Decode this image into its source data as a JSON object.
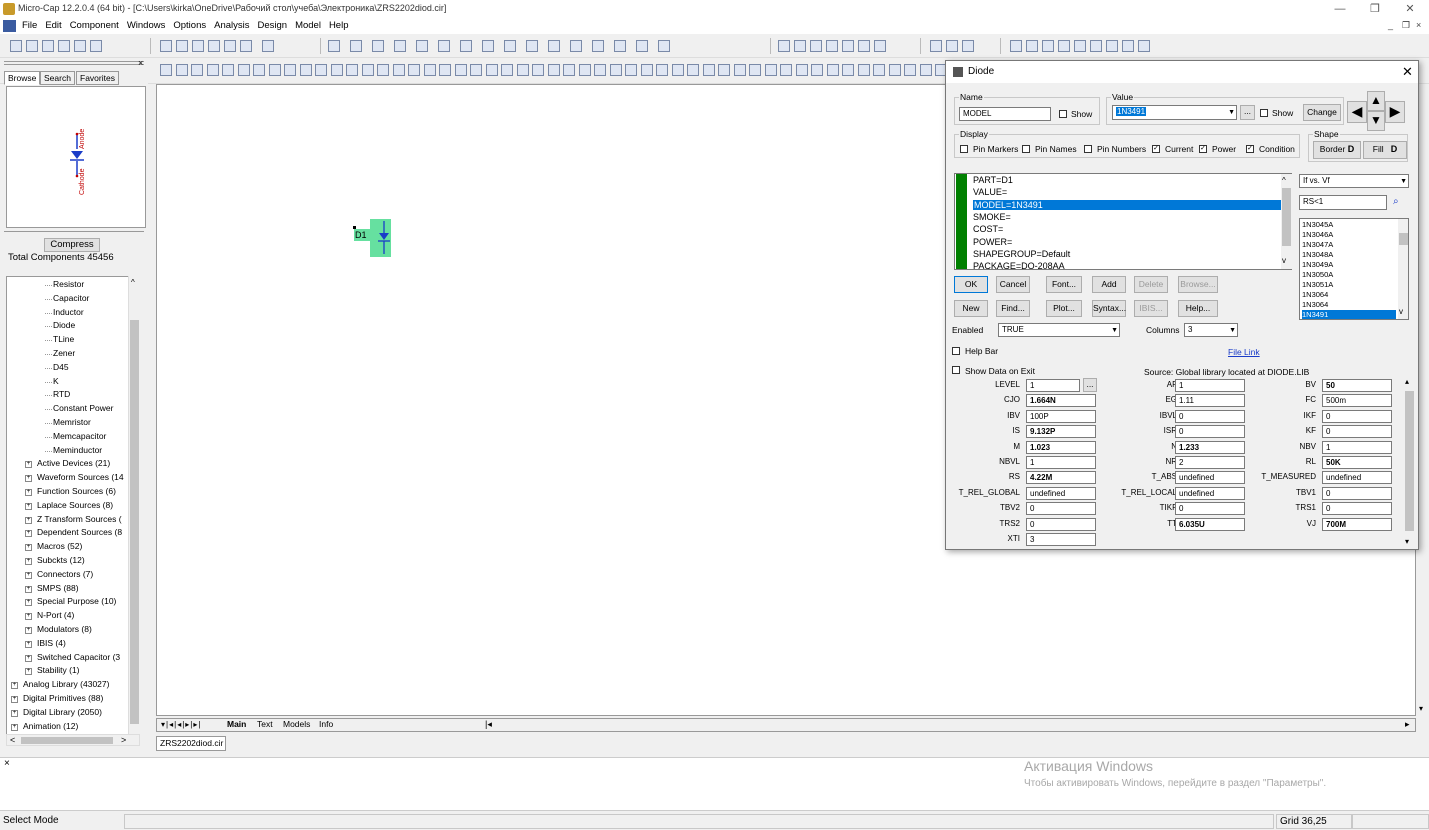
{
  "window": {
    "title": "Micro-Cap 12.2.0.4 (64 bit) - [C:\\Users\\kirka\\OneDrive\\Рабочий стол\\учеба\\Электроника\\ZRS2202diod.cir]",
    "minimize": "—",
    "restore": "❐",
    "close": "✕"
  },
  "menu": [
    "File",
    "Edit",
    "Component",
    "Windows",
    "Options",
    "Analysis",
    "Design",
    "Model",
    "Help"
  ],
  "left_panel": {
    "tabs": [
      "Browse",
      "Search",
      "Favorites"
    ],
    "preview_labels": {
      "anode": "Anode",
      "cathode": "Cathode"
    },
    "compress_button": "Compress",
    "total_components": "Total Components 45456",
    "tree": [
      {
        "label": "Resistor",
        "level": 3
      },
      {
        "label": "Capacitor",
        "level": 3
      },
      {
        "label": "Inductor",
        "level": 3
      },
      {
        "label": "Diode",
        "level": 3
      },
      {
        "label": "TLine",
        "level": 3
      },
      {
        "label": "Zener",
        "level": 3
      },
      {
        "label": "D45",
        "level": 3
      },
      {
        "label": "K",
        "level": 3
      },
      {
        "label": "RTD",
        "level": 3
      },
      {
        "label": "Constant Power",
        "level": 3
      },
      {
        "label": "Memristor",
        "level": 3
      },
      {
        "label": "Memcapacitor",
        "level": 3
      },
      {
        "label": "Meminductor",
        "level": 3
      },
      {
        "label": "Active Devices (21)",
        "level": 2
      },
      {
        "label": "Waveform Sources (14",
        "level": 2
      },
      {
        "label": "Function Sources (6)",
        "level": 2
      },
      {
        "label": "Laplace Sources (8)",
        "level": 2
      },
      {
        "label": "Z Transform Sources (",
        "level": 2
      },
      {
        "label": "Dependent Sources (8",
        "level": 2
      },
      {
        "label": "Macros (52)",
        "level": 2
      },
      {
        "label": "Subckts (12)",
        "level": 2
      },
      {
        "label": "Connectors (7)",
        "level": 2
      },
      {
        "label": "SMPS (88)",
        "level": 2
      },
      {
        "label": "Special Purpose (10)",
        "level": 2
      },
      {
        "label": "N-Port (4)",
        "level": 2
      },
      {
        "label": "Modulators (8)",
        "level": 2
      },
      {
        "label": "IBIS (4)",
        "level": 2
      },
      {
        "label": "Switched Capacitor (3",
        "level": 2
      },
      {
        "label": "Stability (1)",
        "level": 2
      },
      {
        "label": "Analog Library (43027)",
        "level": 1
      },
      {
        "label": "Digital Primitives (88)",
        "level": 1
      },
      {
        "label": "Digital Library (2050)",
        "level": 1
      },
      {
        "label": "Animation (12)",
        "level": 1
      }
    ]
  },
  "canvas": {
    "part_label": "D1",
    "sheet_tabs": [
      "Main",
      "Text",
      "Models",
      "Info"
    ],
    "file_tab": "ZRS2202diod.cir"
  },
  "dialog": {
    "title": "Diode",
    "name_group": "Name",
    "name_value": "MODEL",
    "name_show": "Show",
    "value_group": "Value",
    "value_value": "1N3491",
    "value_browse": "...",
    "value_show": "Show",
    "change_button": "Change",
    "display_group": "Display",
    "display_checks": [
      {
        "label": "Pin Markers",
        "checked": false
      },
      {
        "label": "Pin Names",
        "checked": false
      },
      {
        "label": "Pin Numbers",
        "checked": false
      },
      {
        "label": "Current",
        "checked": true
      },
      {
        "label": "Power",
        "checked": true
      },
      {
        "label": "Condition",
        "checked": true
      }
    ],
    "shape_group": "Shape",
    "border_button": "Border",
    "fill_button": "Fill",
    "attributes": [
      "PART=D1",
      "VALUE=",
      "MODEL=1N3491",
      "SMOKE=",
      "COST=",
      "POWER=",
      "SHAPEGROUP=Default",
      "PACKAGE=DO-208AA"
    ],
    "selected_attribute_index": 2,
    "plot_select": "If vs. Vf",
    "filter_value": "RS<1",
    "model_list": [
      "1N3045A",
      "1N3046A",
      "1N3047A",
      "1N3048A",
      "1N3049A",
      "1N3050A",
      "1N3051A",
      "1N3064",
      "1N3064",
      "1N3491"
    ],
    "selected_model_index": 9,
    "buttons_row1": [
      {
        "label": "OK",
        "enabled": true
      },
      {
        "label": "Cancel",
        "enabled": true
      },
      {
        "label": "Font...",
        "enabled": true
      },
      {
        "label": "Add",
        "enabled": true
      },
      {
        "label": "Delete",
        "enabled": false
      },
      {
        "label": "Browse...",
        "enabled": false
      }
    ],
    "buttons_row2": [
      {
        "label": "New",
        "enabled": true
      },
      {
        "label": "Find...",
        "enabled": true
      },
      {
        "label": "Plot...",
        "enabled": true
      },
      {
        "label": "Syntax...",
        "enabled": true
      },
      {
        "label": "IBIS...",
        "enabled": false
      },
      {
        "label": "Help...",
        "enabled": true
      }
    ],
    "enabled_label": "Enabled",
    "enabled_value": "TRUE",
    "columns_label": "Columns",
    "columns_value": "3",
    "help_bar": "Help Bar",
    "file_link": "File Link",
    "show_data_on_exit": "Show Data on Exit",
    "source_text": "Source: Global library located at DIODE.LIB",
    "params": [
      [
        {
          "n": "LEVEL",
          "v": "1",
          "b": false
        },
        {
          "n": "AF",
          "v": "1",
          "b": false
        },
        {
          "n": "BV",
          "v": "50",
          "b": true
        }
      ],
      [
        {
          "n": "CJO",
          "v": "1.664N",
          "b": true
        },
        {
          "n": "EG",
          "v": "1.11",
          "b": false
        },
        {
          "n": "FC",
          "v": "500m",
          "b": false
        }
      ],
      [
        {
          "n": "IBV",
          "v": "100P",
          "b": false
        },
        {
          "n": "IBVL",
          "v": "0",
          "b": false
        },
        {
          "n": "IKF",
          "v": "0",
          "b": false
        }
      ],
      [
        {
          "n": "IS",
          "v": "9.132P",
          "b": true
        },
        {
          "n": "ISR",
          "v": "0",
          "b": false
        },
        {
          "n": "KF",
          "v": "0",
          "b": false
        }
      ],
      [
        {
          "n": "M",
          "v": "1.023",
          "b": true
        },
        {
          "n": "N",
          "v": "1.233",
          "b": true
        },
        {
          "n": "NBV",
          "v": "1",
          "b": false
        }
      ],
      [
        {
          "n": "NBVL",
          "v": "1",
          "b": false
        },
        {
          "n": "NR",
          "v": "2",
          "b": false
        },
        {
          "n": "RL",
          "v": "50K",
          "b": true
        }
      ],
      [
        {
          "n": "RS",
          "v": "4.22M",
          "b": true
        },
        {
          "n": "T_ABS",
          "v": "undefined",
          "b": false
        },
        {
          "n": "T_MEASURED",
          "v": "undefined",
          "b": false
        }
      ],
      [
        {
          "n": "T_REL_GLOBAL",
          "v": "undefined",
          "b": false
        },
        {
          "n": "T_REL_LOCAL",
          "v": "undefined",
          "b": false
        },
        {
          "n": "TBV1",
          "v": "0",
          "b": false
        }
      ],
      [
        {
          "n": "TBV2",
          "v": "0",
          "b": false
        },
        {
          "n": "TIKF",
          "v": "0",
          "b": false
        },
        {
          "n": "TRS1",
          "v": "0",
          "b": false
        }
      ],
      [
        {
          "n": "TRS2",
          "v": "0",
          "b": false
        },
        {
          "n": "TT",
          "v": "6.035U",
          "b": true
        },
        {
          "n": "VJ",
          "v": "700M",
          "b": true
        }
      ],
      [
        {
          "n": "XTI",
          "v": "3",
          "b": false
        }
      ]
    ]
  },
  "watermark": {
    "line1": "Активация Windows",
    "line2": "Чтобы активировать Windows, перейдите в раздел \"Параметры\"."
  },
  "output_close": "×",
  "status": {
    "mode": "Select Mode",
    "grid": "Grid 36,25"
  },
  "colors": {
    "selection": "#0078d7",
    "part_fill": "#66e0a0",
    "diode_blue": "#1a3cc8",
    "pin_label_red": "#c00000",
    "attr_bar_green": "#008000"
  }
}
